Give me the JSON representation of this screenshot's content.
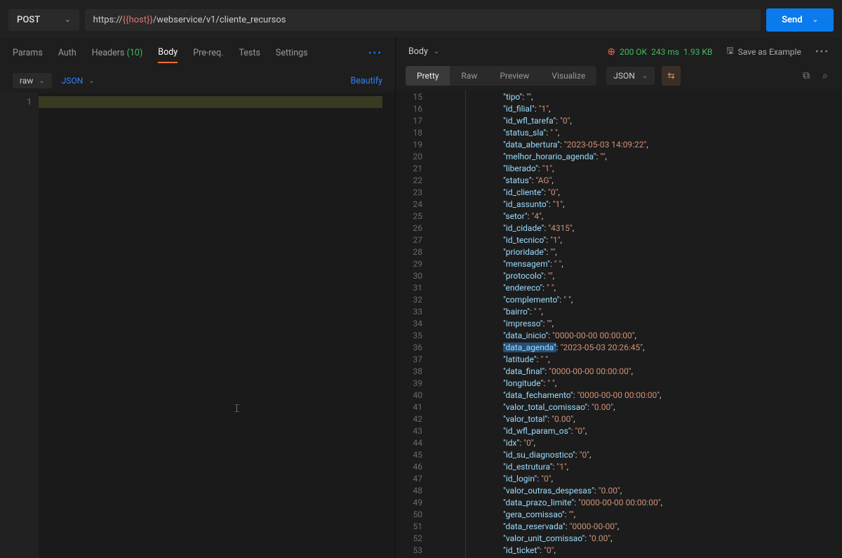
{
  "request": {
    "method": "POST",
    "url_prefix": "https://",
    "url_var": "{{host}}",
    "url_path": "/webservice/v1/cliente_recursos",
    "send_label": "Send"
  },
  "req_tabs": {
    "params": "Params",
    "auth": "Auth",
    "headers": "Headers",
    "headers_count": "(10)",
    "body": "Body",
    "prereq": "Pre-req.",
    "tests": "Tests",
    "settings": "Settings"
  },
  "req_sub": {
    "raw": "raw",
    "json": "JSON",
    "beautify": "Beautify"
  },
  "left_editor": {
    "line1": "1"
  },
  "resp_top": {
    "body": "Body",
    "status_code": "200 OK",
    "time": "243 ms",
    "size": "1.93 KB",
    "save_example": "Save as Example"
  },
  "resp_sub": {
    "pretty": "Pretty",
    "raw": "Raw",
    "preview": "Preview",
    "visualize": "Visualize",
    "json": "JSON"
  },
  "response_lines": [
    {
      "n": "15",
      "k": "tipo",
      "v": ""
    },
    {
      "n": "16",
      "k": "id_filial",
      "v": "1"
    },
    {
      "n": "17",
      "k": "id_wfl_tarefa",
      "v": "0"
    },
    {
      "n": "18",
      "k": "status_sla",
      "v": " "
    },
    {
      "n": "19",
      "k": "data_abertura",
      "v": "2023-05-03 14:09:22"
    },
    {
      "n": "20",
      "k": "melhor_horario_agenda",
      "v": ""
    },
    {
      "n": "21",
      "k": "liberado",
      "v": "1"
    },
    {
      "n": "22",
      "k": "status",
      "v": "AG"
    },
    {
      "n": "23",
      "k": "id_cliente",
      "v": "0"
    },
    {
      "n": "24",
      "k": "id_assunto",
      "v": "1"
    },
    {
      "n": "25",
      "k": "setor",
      "v": "4"
    },
    {
      "n": "26",
      "k": "id_cidade",
      "v": "4315"
    },
    {
      "n": "27",
      "k": "id_tecnico",
      "v": "1"
    },
    {
      "n": "28",
      "k": "prioridade",
      "v": ""
    },
    {
      "n": "29",
      "k": "mensagem",
      "v": " "
    },
    {
      "n": "30",
      "k": "protocolo",
      "v": ""
    },
    {
      "n": "31",
      "k": "endereco",
      "v": " "
    },
    {
      "n": "32",
      "k": "complemento",
      "v": " "
    },
    {
      "n": "33",
      "k": "bairro",
      "v": " "
    },
    {
      "n": "34",
      "k": "impresso",
      "v": ""
    },
    {
      "n": "35",
      "k": "data_inicio",
      "v": "0000-00-00 00:00:00"
    },
    {
      "n": "36",
      "k": "data_agenda",
      "v": "2023-05-03 20:26:45",
      "hl": true
    },
    {
      "n": "37",
      "k": "latitude",
      "v": " "
    },
    {
      "n": "38",
      "k": "data_final",
      "v": "0000-00-00 00:00:00"
    },
    {
      "n": "39",
      "k": "longitude",
      "v": " "
    },
    {
      "n": "40",
      "k": "data_fechamento",
      "v": "0000-00-00 00:00:00"
    },
    {
      "n": "41",
      "k": "valor_total_comissao",
      "v": "0.00"
    },
    {
      "n": "42",
      "k": "valor_total",
      "v": "0.00"
    },
    {
      "n": "43",
      "k": "id_wfl_param_os",
      "v": "0"
    },
    {
      "n": "44",
      "k": "idx",
      "v": "0"
    },
    {
      "n": "45",
      "k": "id_su_diagnostico",
      "v": "0"
    },
    {
      "n": "46",
      "k": "id_estrutura",
      "v": "1"
    },
    {
      "n": "47",
      "k": "id_login",
      "v": "0"
    },
    {
      "n": "48",
      "k": "valor_outras_despesas",
      "v": "0.00"
    },
    {
      "n": "49",
      "k": "data_prazo_limite",
      "v": "0000-00-00 00:00:00"
    },
    {
      "n": "50",
      "k": "gera_comissao",
      "v": ""
    },
    {
      "n": "51",
      "k": "data_reservada",
      "v": "0000-00-00"
    },
    {
      "n": "52",
      "k": "valor_unit_comissao",
      "v": "0.00"
    },
    {
      "n": "53",
      "k": "id_ticket",
      "v": "0"
    }
  ]
}
